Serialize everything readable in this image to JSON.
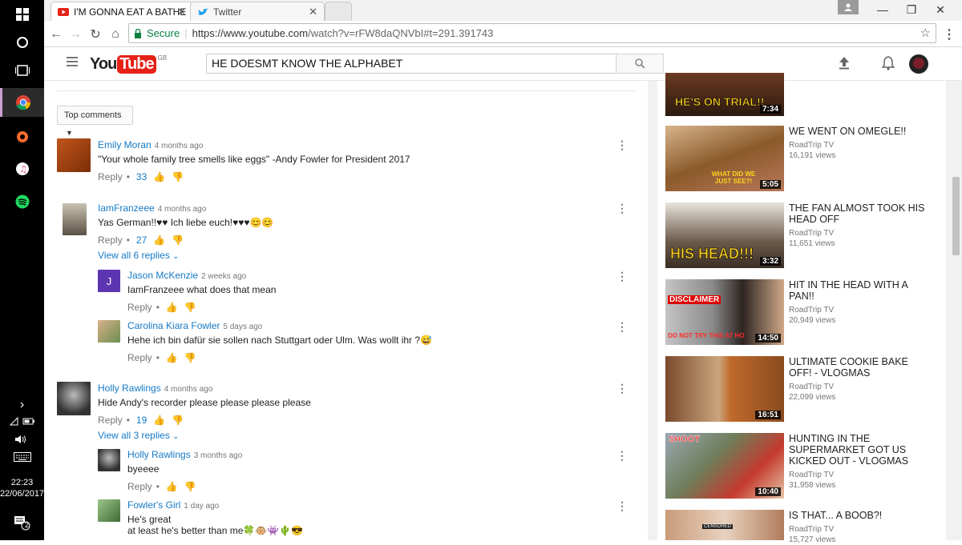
{
  "taskbar": {
    "time": "22:23",
    "date": "22/06/2017",
    "notif_count": "2"
  },
  "browser": {
    "tabs": [
      {
        "title": "I'M GONNA EAT A BATHE"
      },
      {
        "title": "Twitter"
      }
    ],
    "secure_label": "Secure",
    "url_domain": "https://www.youtube.com",
    "url_path": "/watch?v=rFW8daQNVbI#t=291.391743"
  },
  "youtube": {
    "logo_you": "You",
    "logo_tube": "Tube",
    "region": "GB",
    "search_value": "HE DOESMT KNOW THE ALPHABET"
  },
  "comments": {
    "sort_label": "Top comments",
    "reply_label": "Reply",
    "dot": "•",
    "threads": [
      {
        "author": "Emily Moran",
        "time": "4 months ago",
        "text": "\"Your whole family tree smells like eggs\" -Andy Fowler for President 2017",
        "likes": "33"
      },
      {
        "author": "IamFranzeee",
        "time": "4 months ago",
        "text": "Yas German!!♥♥ Ich liebe euch!♥♥♥😊😊",
        "likes": "27",
        "view_replies": "View all 6 replies",
        "replies": [
          {
            "author": "Jason McKenzie",
            "time": "2 weeks ago",
            "text": "IamFranzeee what does that mean",
            "avatar_letter": "J"
          },
          {
            "author": "Carolina Kiara Fowler",
            "time": "5 days ago",
            "text": "Hehe ich bin dafür sie sollen nach Stuttgart oder Ulm. Was wollt ihr ?😅"
          }
        ]
      },
      {
        "author": "Holly Rawlings",
        "time": "4 months ago",
        "text": "Hide Andy's recorder please please please please",
        "likes": "19",
        "view_replies": "View all 3 replies",
        "replies": [
          {
            "author": "Holly Rawlings",
            "time": "3 months ago",
            "text": "byeeee"
          },
          {
            "author": "Fowler's Girl",
            "time": "1 day ago",
            "text": "He's great",
            "text2": "at least he's better than me🍀🐵👾🌵😎"
          }
        ]
      }
    ]
  },
  "sidebar": {
    "videos": [
      {
        "thumb_text": "HE'S ON TRIAL!!",
        "duration": "7:34"
      },
      {
        "title": "WE WENT ON OMEGLE!!",
        "channel": "RoadTrip TV",
        "views": "16,191 views",
        "duration": "5:05",
        "thumb_text": "WHAT DID WE JUST SEE?!"
      },
      {
        "title": "THE FAN ALMOST TOOK HIS HEAD OFF",
        "channel": "RoadTrip TV",
        "views": "11,651 views",
        "duration": "3:32",
        "thumb_text": "HIS HEAD!!!"
      },
      {
        "title": "HIT IN THE HEAD WITH A PAN!!",
        "channel": "RoadTrip TV",
        "views": "20,949 views",
        "duration": "14:50",
        "thumb_text": "DISCLAIMER",
        "thumb_text2": "DO NOT TRY THIS AT HO"
      },
      {
        "title": "ULTIMATE COOKIE BAKE OFF! - VLOGMAS",
        "channel": "RoadTrip TV",
        "views": "22,099 views",
        "duration": "16:51"
      },
      {
        "title": "HUNTING IN THE SUPERMARKET GOT US KICKED OUT - VLOGMAS",
        "channel": "RoadTrip TV",
        "views": "31,958 views",
        "duration": "10:40",
        "thumb_text": "SHOOT"
      },
      {
        "title": "IS THAT... A BOOB?!",
        "channel": "RoadTrip TV",
        "views": "15,727 views",
        "thumb_text": "CENSORED"
      }
    ]
  },
  "colors": {
    "youtube_red": "#e62117",
    "link_blue": "#167ac6",
    "secure_green": "#0b8043"
  }
}
